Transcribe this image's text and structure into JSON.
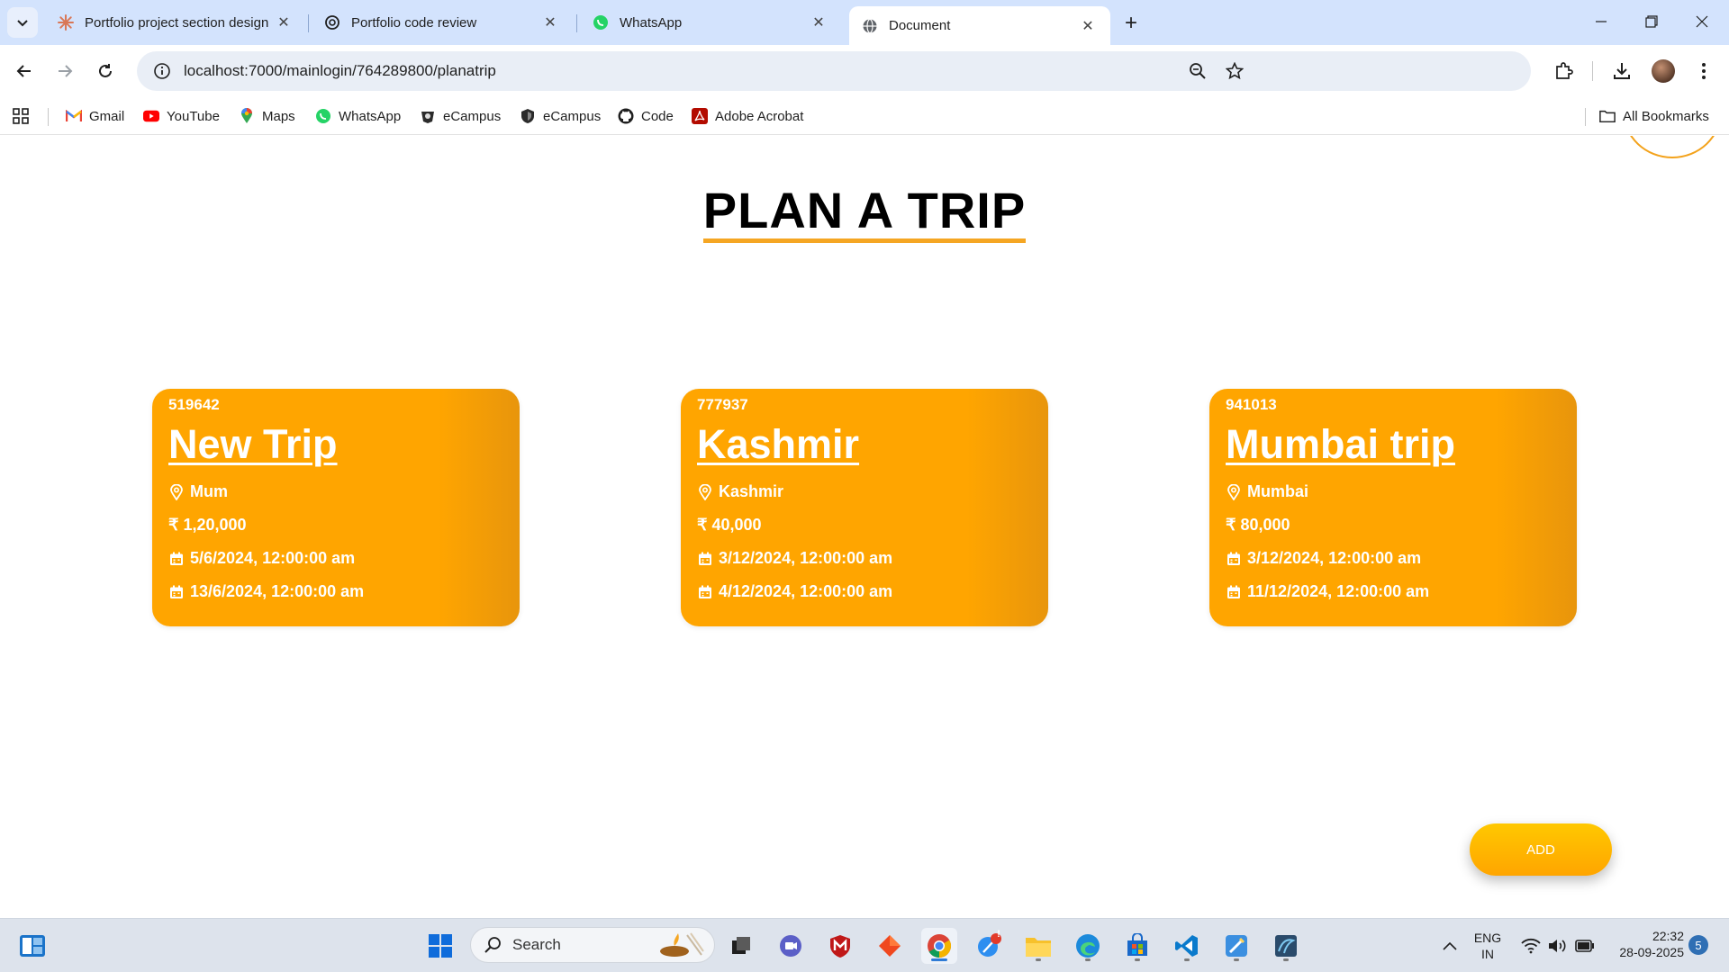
{
  "browser": {
    "tabs": [
      {
        "title": "Portfolio project section design",
        "icon": "claude-icon",
        "active": false
      },
      {
        "title": "Portfolio code review",
        "icon": "chatgpt-icon",
        "active": false
      },
      {
        "title": "WhatsApp",
        "icon": "whatsapp-icon",
        "active": false
      },
      {
        "title": "Document",
        "icon": "globe-icon",
        "active": true
      }
    ],
    "url": "localhost:7000/mainlogin/764289800/planatrip",
    "bookmarks": [
      {
        "label": "Gmail",
        "icon": "gmail-icon"
      },
      {
        "label": "YouTube",
        "icon": "youtube-icon"
      },
      {
        "label": "Maps",
        "icon": "maps-icon"
      },
      {
        "label": "WhatsApp",
        "icon": "whatsapp-icon"
      },
      {
        "label": "eCampus",
        "icon": "ecampus-icon"
      },
      {
        "label": "eCampus",
        "icon": "shield-icon"
      },
      {
        "label": "Code",
        "icon": "github-icon"
      },
      {
        "label": "Adobe Acrobat",
        "icon": "acrobat-icon"
      }
    ],
    "all_bookmarks_label": "All Bookmarks"
  },
  "page": {
    "title": "PLAN A TRIP",
    "accent_color": "#ffa500",
    "trips": [
      {
        "code": "519642",
        "name": "New Trip",
        "location": "Mum",
        "budget": "₹ 1,20,000",
        "start": "5/6/2024, 12:00:00 am",
        "end": "13/6/2024, 12:00:00 am"
      },
      {
        "code": "777937",
        "name": "Kashmir",
        "location": "Kashmir",
        "budget": "₹ 40,000",
        "start": "3/12/2024, 12:00:00 am",
        "end": "4/12/2024, 12:00:00 am"
      },
      {
        "code": "941013",
        "name": "Mumbai trip",
        "location": "Mumbai",
        "budget": "₹ 80,000",
        "start": "3/12/2024, 12:00:00 am",
        "end": "11/12/2024, 12:00:00 am"
      }
    ],
    "add_button_label": "ADD"
  },
  "taskbar": {
    "search_label": "Search",
    "language_line1": "ENG",
    "language_line2": "IN",
    "time": "22:32",
    "date": "28-09-2025",
    "notification_count": "5",
    "badge_alert": "!"
  }
}
